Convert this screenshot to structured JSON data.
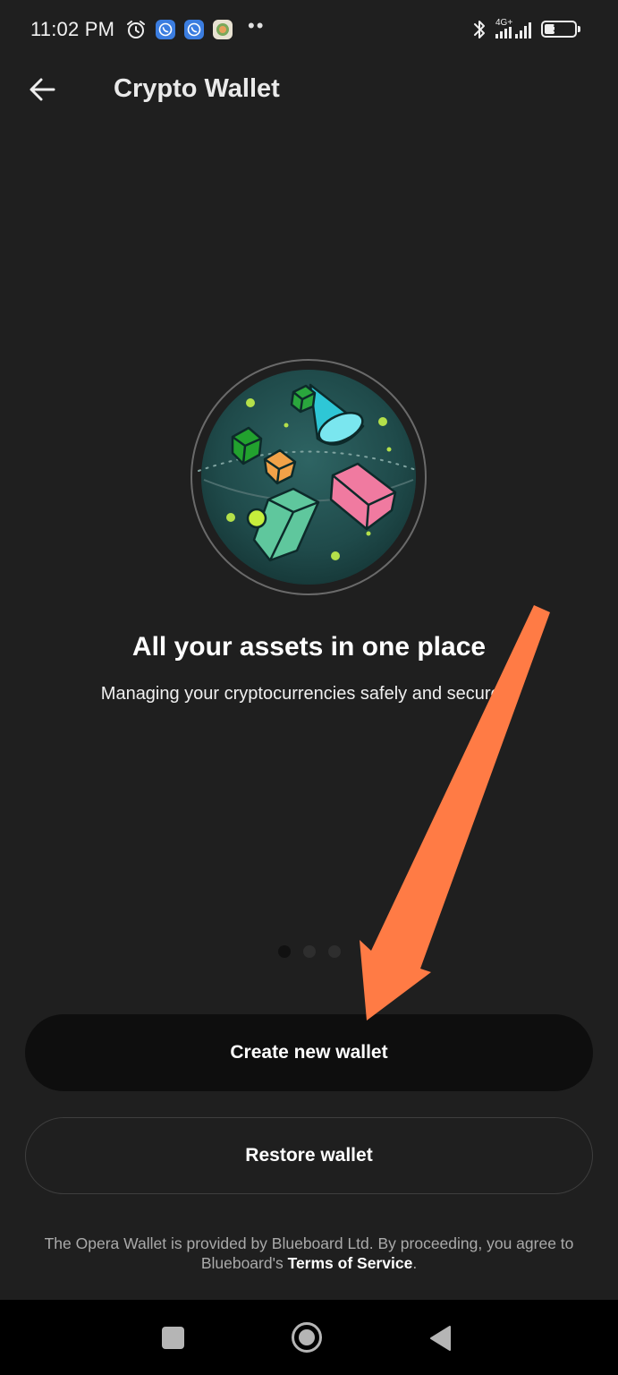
{
  "status_bar": {
    "time": "11:02 PM",
    "network": "4G+",
    "battery": "34",
    "battery_level": 0.34,
    "overflow_dots": "••",
    "icons": [
      "alarm-icon",
      "whatsapp-icon",
      "whatsapp-business-icon",
      "app-notification-icon",
      "bluetooth-icon",
      "signal-icon",
      "battery-icon"
    ]
  },
  "header": {
    "back_icon": "back-arrow-icon",
    "title": "Crypto Wallet"
  },
  "onboarding": {
    "illustration_icon": "crypto-assets-globe-illustration",
    "headline": "All your assets in one place",
    "subtitle": "Managing your cryptocurrencies safely and securely.",
    "pages": 3,
    "active_page": 1
  },
  "actions": {
    "create_label": "Create new wallet",
    "restore_label": "Restore wallet"
  },
  "disclaimer": {
    "text_before": "The Opera Wallet is provided by Blueboard Ltd. By proceeding, you agree to Blueboard's ",
    "link": "Terms of Service",
    "text_after": "."
  },
  "nav_bar": {
    "icons": [
      "recent-apps-icon",
      "home-icon",
      "back-icon"
    ]
  },
  "annotation": {
    "color": "#ff7b45",
    "icon": "pointer-arrow-annotation"
  },
  "colors": {
    "background": "#1f1f1f",
    "primary_button": "#0e0e0e",
    "text": "#ffffff",
    "muted_text": "#aaaaaa"
  }
}
